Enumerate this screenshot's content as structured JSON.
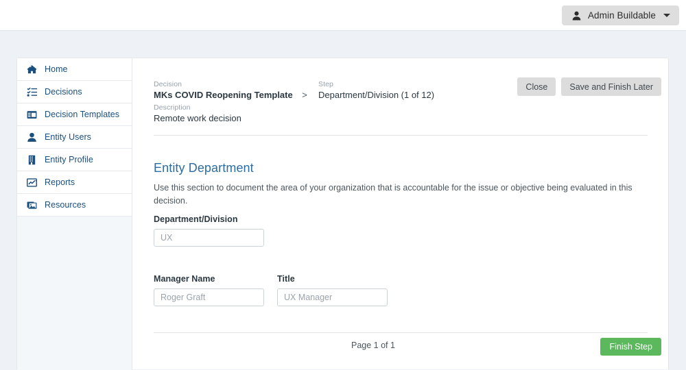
{
  "navbar": {
    "user_name": "Admin Buildable",
    "user_icon": "person-icon",
    "caret_icon": "chevron-down-icon"
  },
  "sidebar": {
    "items": [
      {
        "label": "Home",
        "icon": "home-icon"
      },
      {
        "label": "Decisions",
        "icon": "task-list-icon"
      },
      {
        "label": "Decision Templates",
        "icon": "table-window-icon"
      },
      {
        "label": "Entity Users",
        "icon": "person-icon"
      },
      {
        "label": "Entity Profile",
        "icon": "building-icon"
      },
      {
        "label": "Reports",
        "icon": "chart-line-icon"
      },
      {
        "label": "Resources",
        "icon": "images-stack-icon"
      }
    ]
  },
  "breadcrumb": {
    "decision_label": "Decision",
    "decision_value": "MKs COVID Reopening Template",
    "separator": ">",
    "step_label": "Step",
    "step_value": "Department/Division (1 of 12)",
    "description_label": "Description",
    "description_value": "Remote work decision"
  },
  "toolbar": {
    "close_label": "Close",
    "save_label": "Save and Finish Later"
  },
  "section": {
    "title": "Entity Department",
    "description": "Use this section to document the area of your organization that is accountable for the issue or objective being evaluated in this decision."
  },
  "form": {
    "department": {
      "label": "Department/Division",
      "value": "",
      "placeholder": "UX"
    },
    "manager": {
      "label": "Manager Name",
      "value": "",
      "placeholder": "Roger Graft"
    },
    "title": {
      "label": "Title",
      "value": "",
      "placeholder": "UX Manager"
    }
  },
  "footer": {
    "page_count": "Page 1 of 1",
    "finish_label": "Finish Step"
  },
  "colors": {
    "page_background": "#eef2f6",
    "nav_text": "#1b4f7e",
    "section_title": "#2d6ca2",
    "primary_button": "#5cb85c",
    "secondary_button": "#dcdcdc"
  }
}
